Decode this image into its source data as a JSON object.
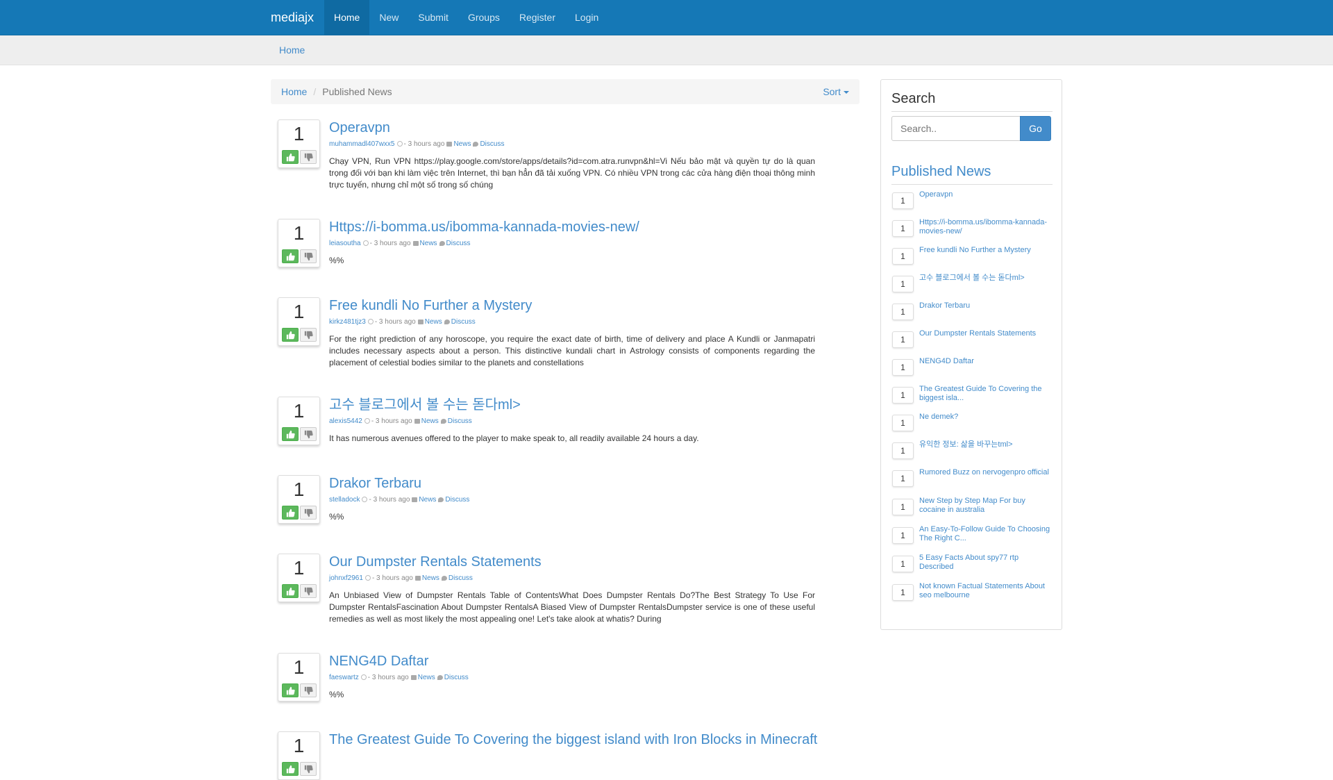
{
  "navbar": {
    "brand": "mediajx",
    "items": [
      "Home",
      "New",
      "Submit",
      "Groups",
      "Register",
      "Login"
    ]
  },
  "subbar": {
    "crumb": "Home"
  },
  "breadcrumb": {
    "home": "Home",
    "current": "Published News",
    "sort": "Sort"
  },
  "stories": [
    {
      "votes": "1",
      "title": "Operavpn",
      "user": "muhammadl407wxx5",
      "time": "- 3 hours ago",
      "category": "News",
      "discuss": "Discuss",
      "desc": "Chạy VPN, Run VPN https://play.google.com/store/apps/details?id=com.atra.runvpn&hl=Vi Nếu bảo mật và quyền tự do là quan trọng đối với bạn khi làm việc trên Internet, thì bạn hẳn đã tải xuống VPN. Có nhiều VPN trong các cửa hàng điện thoại thông minh trực tuyến, nhưng chỉ một số trong số chúng"
    },
    {
      "votes": "1",
      "title": "Https://i-bomma.us/ibomma-kannada-movies-new/",
      "user": "leiasoutha",
      "time": "- 3 hours ago",
      "category": "News",
      "discuss": "Discuss",
      "desc": "%%"
    },
    {
      "votes": "1",
      "title": "Free kundli No Further a Mystery",
      "user": "kirkz481tjz3",
      "time": "- 3 hours ago",
      "category": "News",
      "discuss": "Discuss",
      "desc": "For the right prediction of any horoscope, you require the exact date of birth, time of delivery and place A Kundli or Janmapatri includes necessary aspects about a person. This distinctive kundali chart in Astrology consists of components regarding the placement of celestial bodies similar to the planets and constellations"
    },
    {
      "votes": "1",
      "title": "고수 블로그에서 볼 수는 돋다ml>",
      "user": "alexis5442",
      "time": "- 3 hours ago",
      "category": "News",
      "discuss": "Discuss",
      "desc": "It has numerous avenues offered to the player to make speak to, all readily available 24 hours a day."
    },
    {
      "votes": "1",
      "title": "Drakor Terbaru",
      "user": "stelladock",
      "time": "- 3 hours ago",
      "category": "News",
      "discuss": "Discuss",
      "desc": "%%"
    },
    {
      "votes": "1",
      "title": "Our Dumpster Rentals Statements",
      "user": "johnxf2961",
      "time": "- 3 hours ago",
      "category": "News",
      "discuss": "Discuss",
      "desc": "An Unbiased View of Dumpster Rentals Table of ContentsWhat Does Dumpster Rentals Do?The Best Strategy To Use For Dumpster RentalsFascination About Dumpster RentalsA Biased View of Dumpster RentalsDumpster service is one of these useful remedies as well as most likely the most appealing one! Let's take alook at whatis? During"
    },
    {
      "votes": "1",
      "title": "NENG4D Daftar",
      "user": "faeswartz",
      "time": "- 3 hours ago",
      "category": "News",
      "discuss": "Discuss",
      "desc": "%%"
    },
    {
      "votes": "1",
      "title": "The Greatest Guide To Covering the biggest island with Iron Blocks in Minecraft",
      "user": "",
      "time": "",
      "category": "",
      "discuss": "",
      "desc": ""
    }
  ],
  "sidebar": {
    "search_heading": "Search",
    "search_placeholder": "Search..",
    "go": "Go",
    "published_heading": "Published News",
    "items": [
      {
        "count": "1",
        "label": "Operavpn"
      },
      {
        "count": "1",
        "label": "Https://i-bomma.us/ibomma-kannada-movies-new/"
      },
      {
        "count": "1",
        "label": "Free kundli No Further a Mystery"
      },
      {
        "count": "1",
        "label": "고수 블로그에서 볼 수는 돋다ml>"
      },
      {
        "count": "1",
        "label": "Drakor Terbaru"
      },
      {
        "count": "1",
        "label": "Our Dumpster Rentals Statements"
      },
      {
        "count": "1",
        "label": "NENG4D Daftar"
      },
      {
        "count": "1",
        "label": "The Greatest Guide To Covering the biggest isla..."
      },
      {
        "count": "1",
        "label": "Ne demek?"
      },
      {
        "count": "1",
        "label": "유익한 정보: 삶을 바꾸는tml>"
      },
      {
        "count": "1",
        "label": "Rumored Buzz on nervogenpro official"
      },
      {
        "count": "1",
        "label": "New Step by Step Map For buy cocaine in australia"
      },
      {
        "count": "1",
        "label": "An Easy-To-Follow Guide To Choosing The Right C..."
      },
      {
        "count": "1",
        "label": "5 Easy Facts About spy77 rtp Described"
      },
      {
        "count": "1",
        "label": "Not known Factual Statements About seo melbourne"
      }
    ]
  },
  "colors": {
    "navbar": "#1578b6",
    "link": "#428bca",
    "upvote": "#5cb85c"
  }
}
